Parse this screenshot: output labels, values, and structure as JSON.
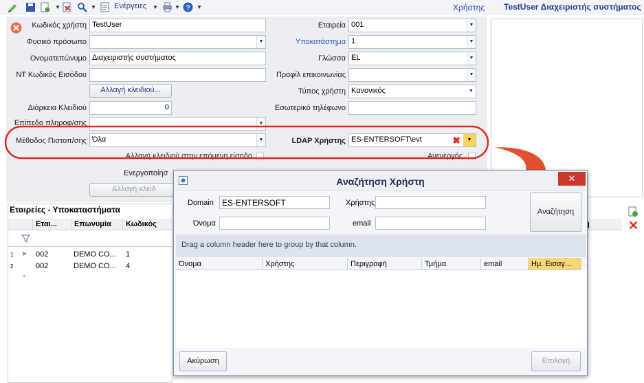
{
  "toolbar": {
    "actions_label": "Ενέργειες",
    "icons": [
      "edit-icon",
      "save-icon",
      "new-record-icon",
      "delete-icon",
      "search-icon",
      "document-icon",
      "print-icon",
      "help-icon"
    ]
  },
  "header": {
    "entity_label": "Χρήστης",
    "record_title": "TestUser Διαχειριστής συστήματος"
  },
  "form": {
    "left": [
      {
        "label": "Κωδικός χρήστη",
        "value": "TestUser"
      },
      {
        "label": "Φυσικό πρόσωπο",
        "value": ""
      },
      {
        "label": "Ονοματεπώνυμο",
        "value": "Διαχειριστής συστήματος"
      },
      {
        "label": "NT Κωδικός Εισόδου",
        "value": ""
      },
      {
        "label": "Διάρκεια Κλειδιού",
        "value": "0"
      },
      {
        "label": "Επίπεδο πληροφ/σης",
        "value": ""
      },
      {
        "label": "Μέθοδος Πιστοπ/σης",
        "value": "Όλα"
      }
    ],
    "change_key_button": "Αλλαγή κλειδιού...",
    "change_key_next_login": "Αλλαγή κλειδιού στην επόμενη είσοδο",
    "activation_label": "Ενεργοποίησ",
    "change_key_button2": "Αλλαγή κλειδ",
    "right": [
      {
        "label": "Εταιρεία",
        "value": "001"
      },
      {
        "label": "Υποκατάστημα",
        "value": "1"
      },
      {
        "label": "Γλώσσα",
        "value": "EL"
      },
      {
        "label": "Προφίλ επικοινωνίας",
        "value": ""
      },
      {
        "label": "Τύπος χρήστη",
        "value": "Κανονικός"
      },
      {
        "label": "Εσωτερικό τηλέφωνο",
        "value": ""
      }
    ],
    "ldap_label": "LDAP Χρήστης",
    "ldap_value": "ES-ENTERSOFT\\evt",
    "inactive_label": "Ανενεργός"
  },
  "grid": {
    "title": "Εταιρείες - Υποκαταστήματα",
    "headers": [
      "Εται...",
      "Επωνυμία",
      "Κωδικός"
    ],
    "rows": [
      {
        "num": "1",
        "c1": "002",
        "c2": "DEMO CO...",
        "c3": "1"
      },
      {
        "num": "2",
        "c1": "002",
        "c2": "DEMO CO...",
        "c3": "4"
      }
    ],
    "right_col_header": "ή"
  },
  "dialog": {
    "title": "Αναζήτηση Χρήστη",
    "domain_label": "Domain",
    "domain_value": "ES-ENTERSOFT",
    "user_label": "Χρήστης",
    "user_value": "",
    "name_label": "Όνομα",
    "name_value": "",
    "email_label": "email",
    "email_value": "",
    "search_button": "Αναζήτηση",
    "group_hint": "Drag a column header here to group by that column.",
    "columns": [
      "Όνομα",
      "Χρήστης",
      "Περιγραφή",
      "Τμήμα",
      "email",
      "Ημ. Εισαγ..."
    ],
    "cancel_button": "Ακύρωση",
    "select_button": "Επιλογή"
  },
  "colors": {
    "highlight": "#e02a1e",
    "arrow": "#e4502f"
  }
}
